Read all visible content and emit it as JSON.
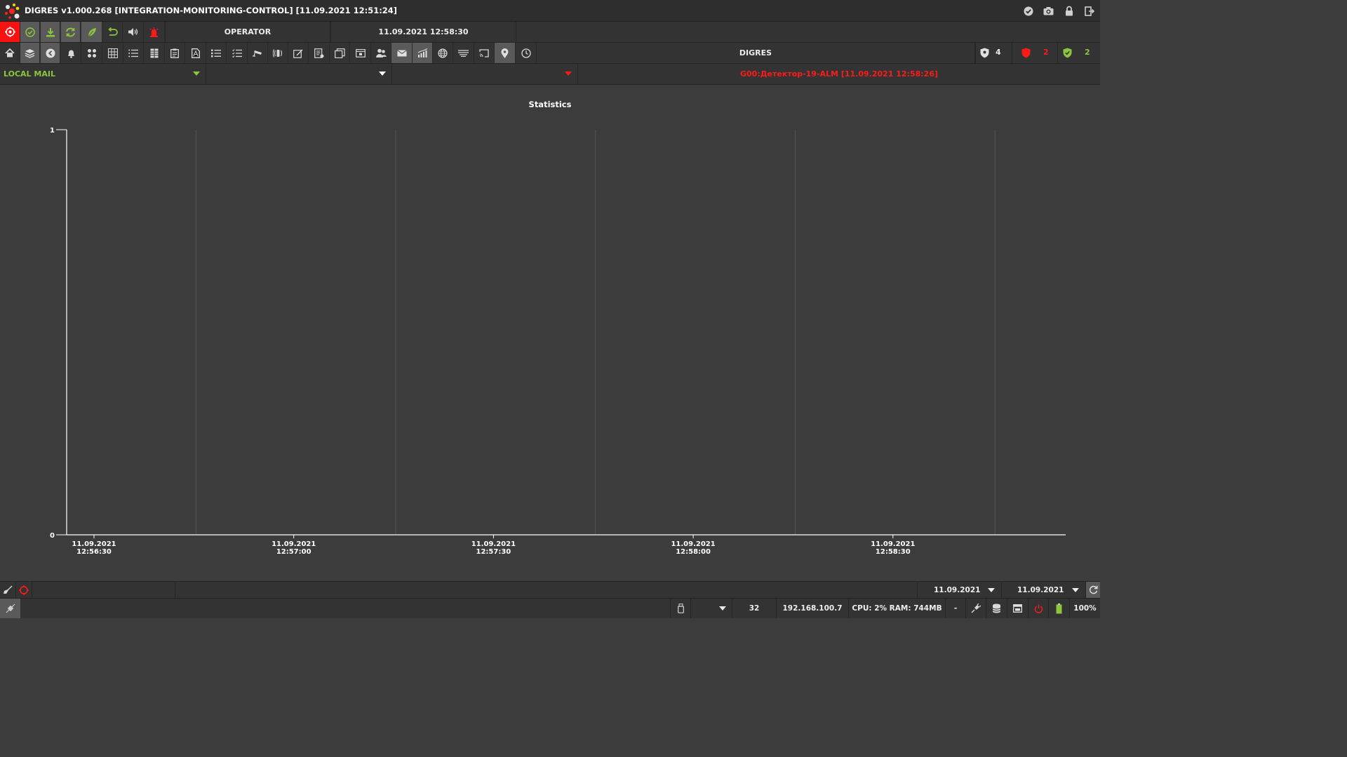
{
  "titlebar": {
    "title": "DIGRES v1.000.268 [INTEGRATION-MONITORING-CONTROL] [11.09.2021 12:51:24]",
    "icons": [
      "check-circle-icon",
      "camera-icon",
      "lock-icon",
      "exit-icon"
    ]
  },
  "toolbar1": {
    "user": "OPERATOR",
    "datetime": "11.09.2021 12:58:30",
    "buttons": [
      "alarm-target-icon",
      "check-circle-icon",
      "download-icon",
      "sync-icon",
      "leaf-icon",
      "undo-icon",
      "sound-icon",
      "siren-icon"
    ]
  },
  "toolbar2": {
    "system_name": "DIGRES",
    "counters": [
      {
        "icon": "shield-icon",
        "value": "4",
        "color": "#ececec"
      },
      {
        "icon": "shield-alarm-icon",
        "value": "2",
        "color": "#ff1a1a"
      },
      {
        "icon": "shield-ok-icon",
        "value": "2",
        "color": "#8cc63f"
      }
    ]
  },
  "filters": {
    "source": "LOCAL MAIL",
    "second": "",
    "third": "",
    "last_event": "G00:Детектор-19-ALM [11.09.2021 12:58:26]"
  },
  "chart_data": {
    "type": "line",
    "title": "Statistics",
    "ylim": [
      0,
      1
    ],
    "yticks": [
      "1",
      "0"
    ],
    "x": [
      "11.09.2021 12:56:30",
      "11.09.2021 12:57:00",
      "11.09.2021 12:57:30",
      "11.09.2021 12:58:00",
      "11.09.2021 12:58:30"
    ],
    "series": [],
    "grid": true
  },
  "bottom1": {
    "date_from": "11.09.2021",
    "date_to": "11.09.2021"
  },
  "bottom2": {
    "count": "32",
    "ip": "192.168.100.7",
    "perf": "CPU: 2% RAM: 744MB",
    "dash": "-",
    "zoom": "100%"
  },
  "colors": {
    "accent_green": "#8cc63f",
    "alarm_red": "#ff1a1a",
    "background": "#3c3c3c"
  }
}
